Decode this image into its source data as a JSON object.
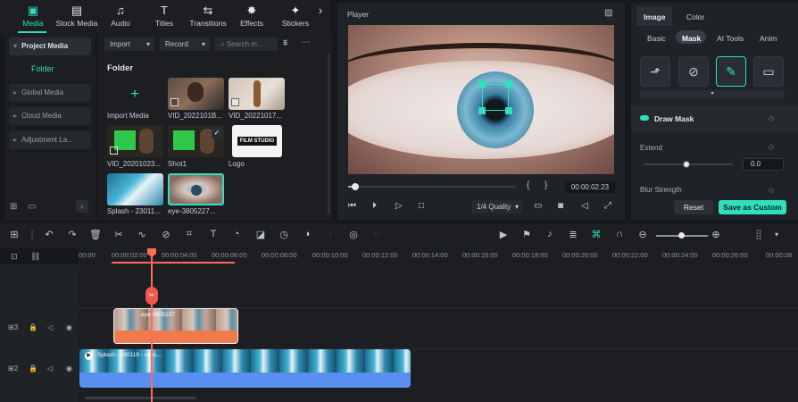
{
  "toolbar": {
    "tabs": [
      {
        "label": "Media",
        "icon": "media-icon",
        "glyph": "▣"
      },
      {
        "label": "Stock Media",
        "icon": "stock-media-icon",
        "glyph": "▤"
      },
      {
        "label": "Audio",
        "icon": "music-icon",
        "glyph": "♫"
      },
      {
        "label": "Titles",
        "icon": "titles-icon",
        "glyph": "T"
      },
      {
        "label": "Transitions",
        "icon": "transitions-icon",
        "glyph": "⇆"
      },
      {
        "label": "Effects",
        "icon": "effects-icon",
        "glyph": "✸"
      },
      {
        "label": "Stickers",
        "icon": "stickers-icon",
        "glyph": "✦"
      }
    ],
    "more": "›"
  },
  "leftnav": {
    "project_media": "Project Media",
    "folder": "Folder",
    "items": [
      "Global Media",
      "Cloud Media",
      "Adjustment La..."
    ]
  },
  "media": {
    "import_dropdown": "Import",
    "record_dropdown": "Record",
    "search_placeholder": "Search m...",
    "folder_title": "Folder",
    "import_label": "Import Media",
    "items": [
      {
        "caption": "VID_2022101B..."
      },
      {
        "caption": "VID_20221017..."
      },
      {
        "caption": "VID_20201023..."
      },
      {
        "caption": "Shot1"
      },
      {
        "caption": "Logo"
      },
      {
        "caption": "Splash - 23011..."
      },
      {
        "caption": "eye-3805227..."
      }
    ],
    "logo_text": "FILM STUDIO"
  },
  "player": {
    "title": "Player",
    "time": "00:00:02:23",
    "brace_open": "{",
    "brace_close": "}",
    "quality": "1/4 Quality",
    "progress": 0.02
  },
  "right": {
    "tab_image": "Image",
    "tab_color": "Color",
    "subtabs": [
      "Basic",
      "Mask",
      "AI Tools",
      "Anim"
    ],
    "draw_mask": "Draw Mask",
    "extend": "Extend",
    "extend_value": "0.0",
    "blur_strength": "Blur Strength",
    "reset": "Reset",
    "save_custom": "Save as Custom"
  },
  "ruler": {
    "labels": [
      "00:00",
      "00:00:02:00",
      "00:00:04:00",
      "00:00:06:00",
      "00:00:08:00",
      "00:00:10:00",
      "00:00:12:00",
      "00:00:14:00",
      "00:00:16:00",
      "00:00:18:00",
      "00:00:20:00",
      "00:00:22:00",
      "00:00:24:00",
      "00:00:26:00",
      "00:00:28"
    ]
  },
  "tracks": {
    "track3_label": "3",
    "track2_label": "2",
    "clip_eye_label": "eye-3805227",
    "clip_splash_label": "Splash - 230118 - cops..."
  },
  "colors": {
    "accent": "#2ee0bf",
    "playhead": "#ff6b5b",
    "clip_orange": "#f07a4c",
    "clip_blue": "#5a8ff2"
  }
}
